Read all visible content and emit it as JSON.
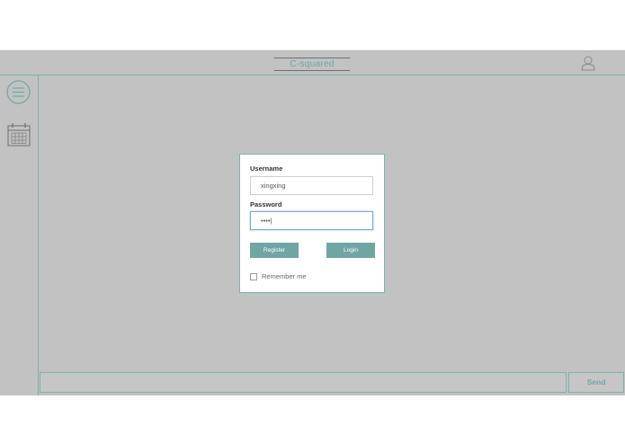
{
  "header": {
    "brand": "C-squared",
    "user_icon": "user-icon"
  },
  "sidebar": {
    "icons": [
      "menu-icon",
      "calendar-icon"
    ]
  },
  "login": {
    "username_label": "Username",
    "username_value": "xingxing",
    "password_label": "Password",
    "password_value": "••••|",
    "register_label": "Register",
    "login_label": "Login",
    "remember_label": "Remember me"
  },
  "footer": {
    "send_label": "Send"
  },
  "colors": {
    "accent": "#6fa6a3",
    "background": "#c2c2c2",
    "border": "#7fb0ae"
  }
}
